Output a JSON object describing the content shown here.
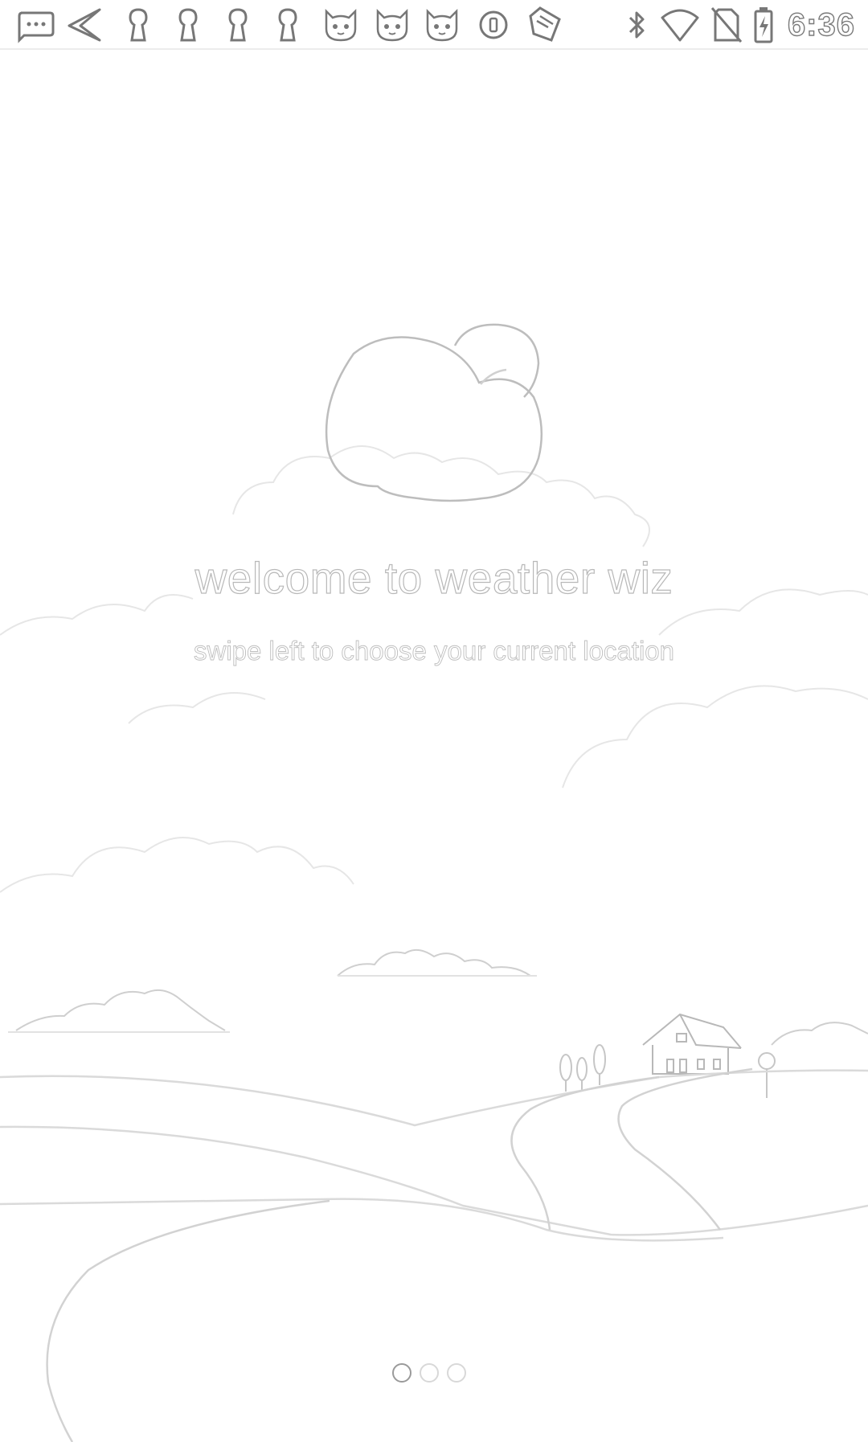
{
  "status_bar": {
    "time": "6:36",
    "left_icons": [
      "chat-bubble-icon",
      "send-icon",
      "keyhole-icon",
      "keyhole-icon",
      "keyhole-icon",
      "keyhole-icon",
      "cat-face-icon",
      "cat-face-icon",
      "cat-face-icon",
      "circle-stop-icon",
      "fav-badge-icon"
    ],
    "right_icons": [
      "bluetooth-icon",
      "wifi-icon",
      "no-sim-icon",
      "battery-charging-icon"
    ]
  },
  "onboarding": {
    "title": "welcome to weather wiz",
    "subtitle": "swipe left to choose your current location"
  },
  "pager": {
    "page_count": 3,
    "current_page": 1
  },
  "colors": {
    "background": "#ffffff",
    "outline": "#c8c8c8",
    "text_outline": "#b8b8b8"
  }
}
